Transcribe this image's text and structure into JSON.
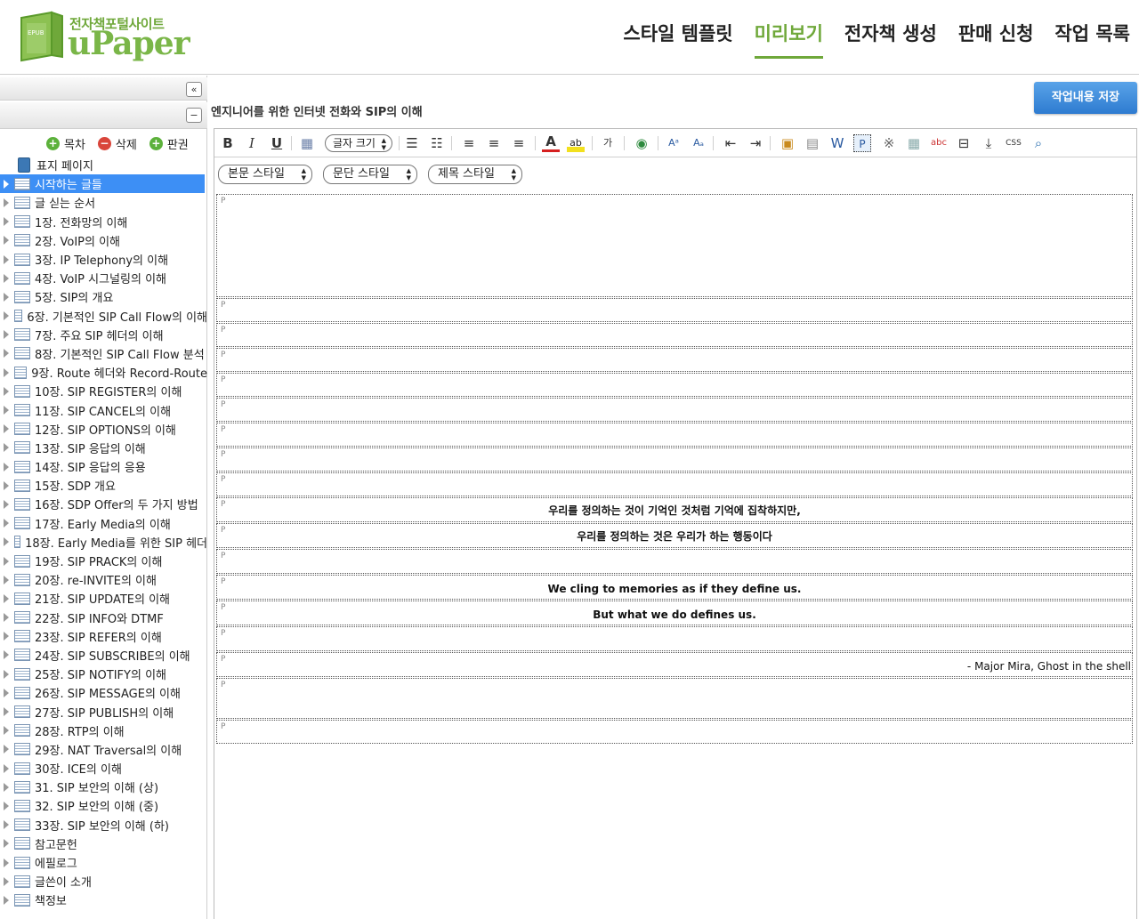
{
  "header": {
    "logo_sub": "전자책포털사이트",
    "logo_main": "uPaper",
    "logo_badge": "EPUB",
    "nav": [
      {
        "label": "스타일 템플릿",
        "active": false
      },
      {
        "label": "미리보기",
        "active": true
      },
      {
        "label": "전자책 생성",
        "active": false
      },
      {
        "label": "판매 신청",
        "active": false
      },
      {
        "label": "작업 목록",
        "active": false
      }
    ]
  },
  "sidebar": {
    "collapse_icon": "«",
    "minus_icon": "−",
    "actions": {
      "toc": "목차",
      "delete": "삭제",
      "copyright": "판권"
    },
    "items": [
      "표지 페이지",
      "시작하는 글들",
      "글 싣는 순서",
      "1장. 전화망의 이해",
      "2장. VoIP의 이해",
      "3장. IP Telephony의 이해",
      "4장. VoIP 시그널링의 이해",
      "5장. SIP의 개요",
      "6장. 기본적인 SIP Call Flow의 이해",
      "7장. 주요 SIP 헤더의 이해",
      "8장. 기본적인 SIP Call Flow 분석",
      "9장. Route 헤더와 Record-Route",
      "10장. SIP REGISTER의 이해",
      "11장. SIP CANCEL의 이해",
      "12장. SIP OPTIONS의 이해",
      "13장. SIP 응답의 이해",
      "14장. SIP 응답의 응용",
      "15장. SDP 개요",
      "16장. SDP Offer의 두 가지 방법",
      "17장. Early Media의 이해",
      "18장. Early Media를 위한 SIP 헤더",
      "19장. SIP PRACK의 이해",
      "20장. re-INVITE의 이해",
      "21장. SIP UPDATE의 이해",
      "22장. SIP INFO와 DTMF",
      "23장. SIP REFER의 이해",
      "24장. SIP SUBSCRIBE의 이해",
      "25장. SIP NOTIFY의 이해",
      "26장. SIP MESSAGE의 이해",
      "27장. SIP PUBLISH의 이해",
      "28장. RTP의 이해",
      "29장. NAT Traversal의 이해",
      "30장. ICE의 이해",
      "31. SIP 보안의 이해 (상)",
      "32. SIP 보안의 이해 (중)",
      "33장. SIP 보안의 이해 (하)",
      "참고문헌",
      "에필로그",
      "글쓴이 소개",
      "책정보"
    ]
  },
  "main": {
    "doc_title": "엔지니어를 위한 인터넷 전화와 SIP의 이해",
    "save_label": "작업내용 저장",
    "toolbar": {
      "font_size_label": "글자 크기",
      "bold": "B",
      "italic": "I",
      "underline": "U"
    },
    "styles": {
      "body": "본문 스타일",
      "paragraph": "문단 스타일",
      "heading": "제목 스타일"
    },
    "paragraph_mark": "P",
    "paragraphs": [
      "",
      "",
      "",
      "",
      "",
      "",
      "",
      "",
      "",
      "우리를 정의하는 것이 기억인 것처럼 기억에 집착하지만,",
      "우리를 정의하는 것은 우리가 하는 행동이다",
      "",
      "We cling to memories as if they define us.",
      "But what we do defines us.",
      "",
      "- Major Mira, Ghost in the shell",
      "",
      ""
    ]
  },
  "colors": {
    "accent_green": "#6fa83a",
    "selected_blue": "#3d8ff5",
    "save_blue": "#2e7bd0"
  }
}
